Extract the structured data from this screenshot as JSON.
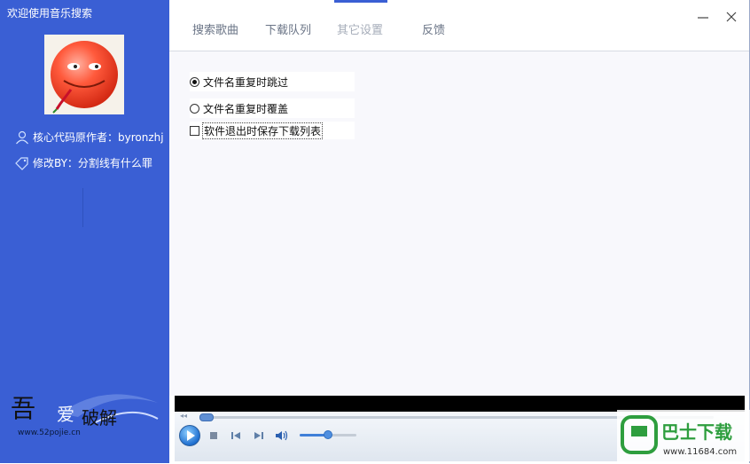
{
  "sidebar": {
    "title": "欢迎使用音乐搜索",
    "author_line": "核心代码原作者：byronzhj",
    "modifier_line": "修改BY：分割线有什么罪",
    "logo_text": "吾爱破解",
    "logo_url_text": "www.52pojie.cn"
  },
  "tabs": [
    {
      "label": "搜索歌曲"
    },
    {
      "label": "下载队列"
    },
    {
      "label": "其它设置"
    },
    {
      "label": "反馈"
    }
  ],
  "active_tab": "其它设置",
  "settings": {
    "skip_duplicate_label": "文件名重复时跳过",
    "overwrite_duplicate_label": "文件名重复时覆盖",
    "save_queue_label": "软件退出时保存下载列表",
    "selected_option": "文件名重复时跳过",
    "save_queue_checked": false
  },
  "player": {
    "seek_fraction": 0.0,
    "volume_fraction": 0.5
  },
  "watermark": {
    "brand": "巴士下载",
    "url": "www.11684.com"
  },
  "colors": {
    "sidebar_bg": "#3a5fd4",
    "accent": "#3a5fd4",
    "watermark_green": "#2e9e3e"
  }
}
